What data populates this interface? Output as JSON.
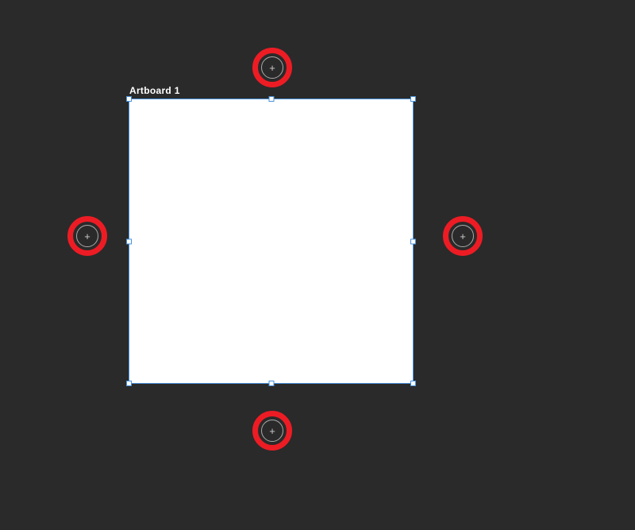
{
  "artboard": {
    "label": "Artboard 1"
  },
  "add_buttons": {
    "glyph": "+"
  }
}
